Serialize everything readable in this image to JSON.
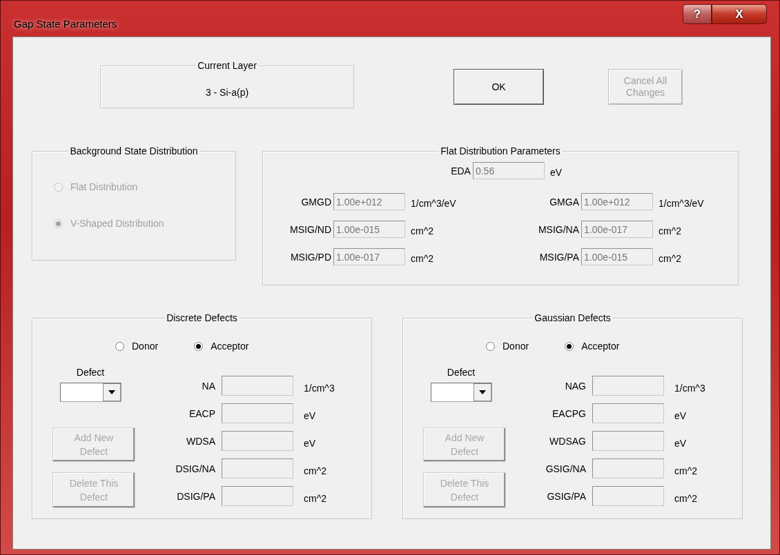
{
  "window": {
    "title": "Gap State Parameters",
    "controls": [
      {
        "kind": "help",
        "glyph": "?"
      },
      {
        "kind": "close",
        "glyph": "X"
      }
    ]
  },
  "current_layer": {
    "title": "Current Layer",
    "value": "3 - Si-a(p)"
  },
  "buttons": [
    {
      "label": "OK",
      "disabled": false
    },
    {
      "label": "Cancel All Changes",
      "disabled": true
    }
  ],
  "background": {
    "title": "Background State Distribution",
    "disabled": true,
    "options": [
      {
        "label": "Flat Distribution",
        "selected": false
      },
      {
        "label": "V-Shaped Distribution",
        "selected": true
      }
    ]
  },
  "flat": {
    "title": "Flat Distribution Parameters",
    "disabled": true,
    "eda": {
      "label": "EDA",
      "value": "0.56",
      "unit": "eV"
    },
    "rows": [
      {
        "left": {
          "label": "GMGD",
          "value": "1.00e+012",
          "unit": "1/cm^3/eV"
        },
        "right": {
          "label": "GMGA",
          "value": "1.00e+012",
          "unit": "1/cm^3/eV"
        }
      },
      {
        "left": {
          "label": "MSIG/ND",
          "value": "1.00e-015",
          "unit": "cm^2"
        },
        "right": {
          "label": "MSIG/NA",
          "value": "1.00e-017",
          "unit": "cm^2"
        }
      },
      {
        "left": {
          "label": "MSIG/PD",
          "value": "1.00e-017",
          "unit": "cm^2"
        },
        "right": {
          "label": "MSIG/PA",
          "value": "1.00e-015",
          "unit": "cm^2"
        }
      }
    ]
  },
  "defect_groups": [
    {
      "title": "Discrete Defects",
      "types": [
        {
          "label": "Donor",
          "selected": false
        },
        {
          "label": "Acceptor",
          "selected": true
        }
      ],
      "defect_label": "Defect",
      "actions": [
        {
          "label": "Add New Defect",
          "disabled": true
        },
        {
          "label": "Delete This Defect",
          "disabled": true
        }
      ],
      "fields": [
        {
          "label": "NA",
          "unit": "1/cm^3"
        },
        {
          "label": "EACP",
          "unit": "eV"
        },
        {
          "label": "WDSA",
          "unit": "eV"
        },
        {
          "label": "DSIG/NA",
          "unit": "cm^2"
        },
        {
          "label": "DSIG/PA",
          "unit": "cm^2"
        }
      ]
    },
    {
      "title": "Gaussian Defects",
      "types": [
        {
          "label": "Donor",
          "selected": false
        },
        {
          "label": "Acceptor",
          "selected": true
        }
      ],
      "defect_label": "Defect",
      "actions": [
        {
          "label": "Add New Defect",
          "disabled": true
        },
        {
          "label": "Delete This Defect",
          "disabled": true
        }
      ],
      "fields": [
        {
          "label": "NAG",
          "unit": "1/cm^3"
        },
        {
          "label": "EACPG",
          "unit": "eV"
        },
        {
          "label": "WDSAG",
          "unit": "eV"
        },
        {
          "label": "GSIG/NA",
          "unit": "cm^2"
        },
        {
          "label": "GSIG/PA",
          "unit": "cm^2"
        }
      ]
    }
  ]
}
